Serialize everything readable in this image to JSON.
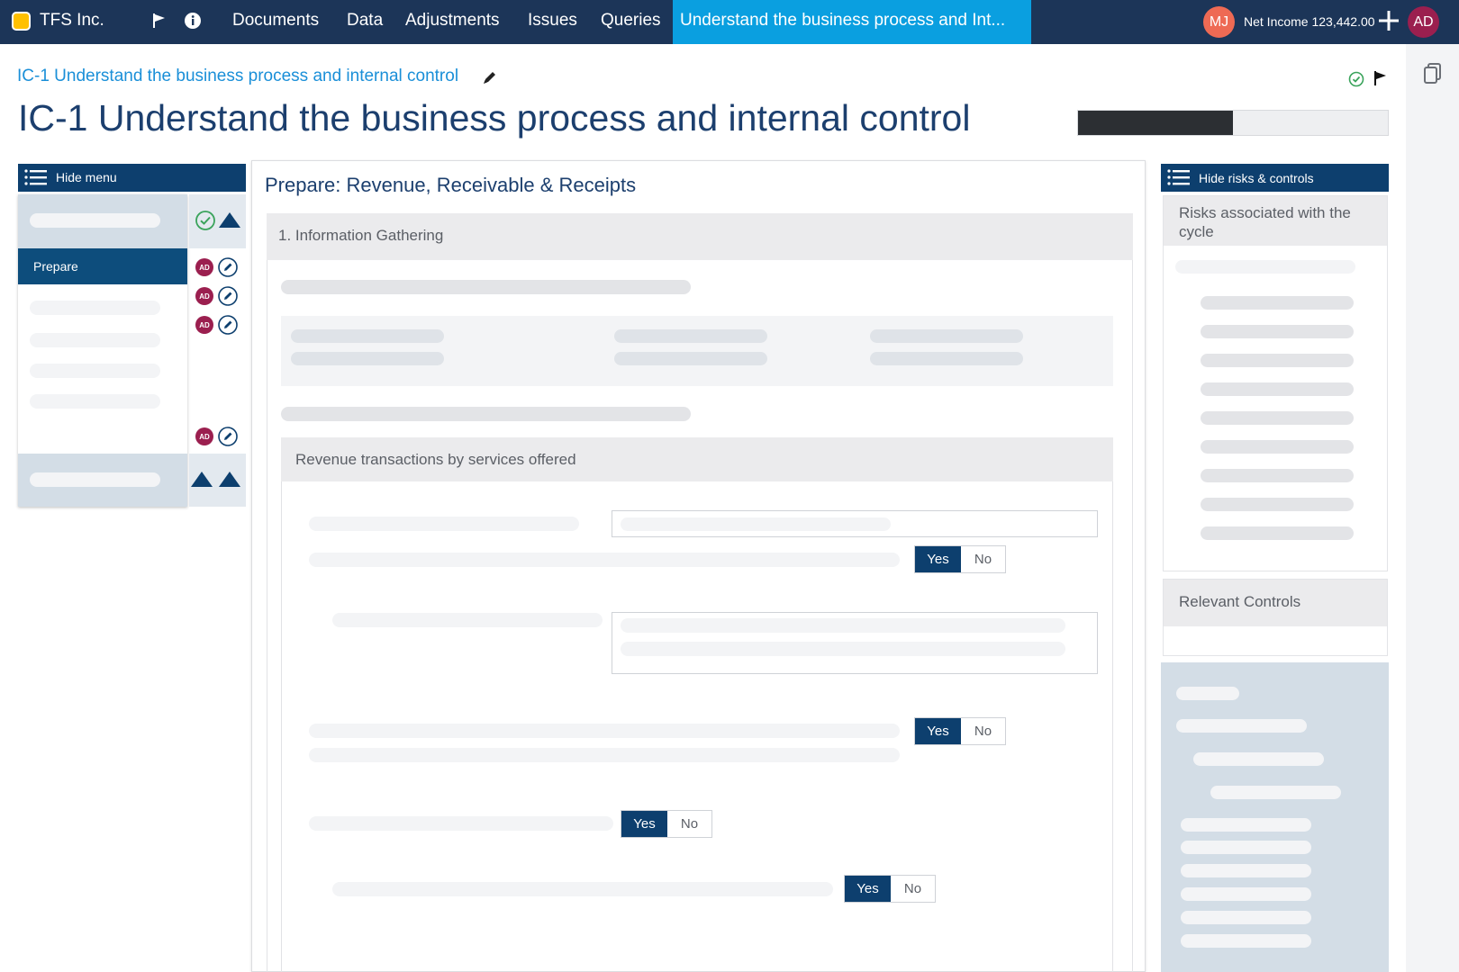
{
  "app": {
    "company": "TFS Inc.",
    "nav": [
      "Documents",
      "Data",
      "Adjustments",
      "Issues",
      "Queries"
    ],
    "active_tab": "Understand the business process and Int...",
    "user_initials_left": "MJ",
    "net_income": "Net Income 123,442.00",
    "user_initials_right": "AD"
  },
  "header": {
    "breadcrumb": "IC-1 Understand the business process and internal control",
    "title": "IC-1 Understand the business process and internal control",
    "progress": 0.5
  },
  "left_menu": {
    "hide_label": "Hide menu",
    "active_item": "Prepare",
    "assignee_badge": "AD"
  },
  "center": {
    "section_title": "Prepare: Revenue, Receivable & Receipts",
    "info_header": "1. Information Gathering",
    "revenue_header": "Revenue transactions by services offered",
    "yes_label": "Yes",
    "no_label": "No"
  },
  "right_panel": {
    "hide_label": "Hide risks & controls",
    "risks_title": "Risks associated with the cycle",
    "controls_title": "Relevant Controls"
  },
  "colors": {
    "topbar": "#1c3558",
    "active_tab": "#0a9fe0",
    "primary": "#0d3f6e",
    "accent_link": "#1a8fd8",
    "badge": "#9b1f4f",
    "avatar_mj": "#ee6a54"
  },
  "icons": [
    "flag-icon",
    "info-icon",
    "plus-icon",
    "copy-icon",
    "pencil-icon",
    "check-circle-icon",
    "list-icon",
    "triangle-up-icon",
    "edit-circle-icon"
  ]
}
